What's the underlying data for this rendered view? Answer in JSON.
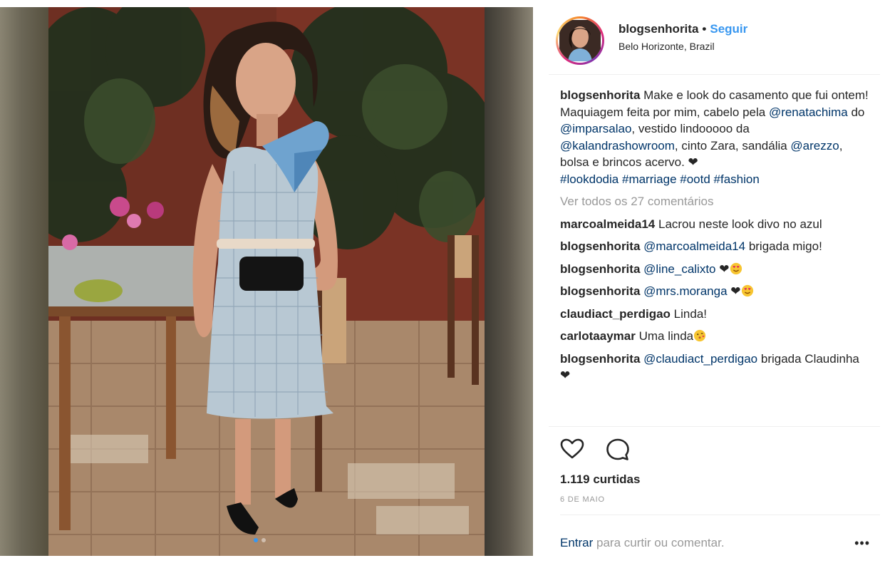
{
  "post": {
    "carousel": {
      "total": 2,
      "active_index": 1
    },
    "header": {
      "username": "blogsenhorita",
      "separator": "•",
      "follow_label": "Seguir",
      "location": "Belo Horizonte, Brazil"
    },
    "caption": {
      "username": "blogsenhorita",
      "t1": " Make e look do casamento que fui ontem! Maquiagem feita por mim, cabelo pela ",
      "m1": "@renatachima",
      "t2": " do ",
      "m2": "@imparsalao",
      "t3": ", vestido lindooooo da ",
      "m3": "@kalandrashowroom",
      "t4": ", cinto Zara, sandália ",
      "m4": "@arezzo",
      "t5": ", bolsa e brincos acervo. ",
      "heart": "❤",
      "hashtags": [
        "#lookdodia",
        "#marriage",
        "#ootd",
        "#fashion"
      ]
    },
    "view_all_comments": "Ver todos os 27 comentários",
    "comments": [
      {
        "username": "marcoalmeida14",
        "text": "Lacrou neste look divo no azul"
      },
      {
        "username": "blogsenhorita",
        "mention": "@marcoalmeida14",
        "text": "brigada migo!"
      },
      {
        "username": "blogsenhorita",
        "mention": "@line_calixto",
        "text": "❤"
      },
      {
        "username": "blogsenhorita",
        "mention": "@mrs.moranga",
        "text": "❤"
      },
      {
        "username": "claudiact_perdigao",
        "text": "Linda!"
      },
      {
        "username": "carlotaaymar",
        "text": "Uma linda"
      },
      {
        "username": "blogsenhorita",
        "mention": "@claudiact_perdigao",
        "text": "brigada Claudinha ❤"
      }
    ],
    "actions": {
      "like_icon": "heart-outline-icon",
      "comment_icon": "speech-bubble-icon"
    },
    "likes": "1.119 curtidas",
    "date": "6 DE MAIO",
    "footer": {
      "login_link": "Entrar",
      "login_text": " para curtir ou comentar.",
      "more": "•••"
    }
  },
  "colors": {
    "link": "#003569",
    "follow_blue": "#3897f0",
    "muted": "#999999",
    "text": "#262626",
    "divider": "#efefef"
  }
}
